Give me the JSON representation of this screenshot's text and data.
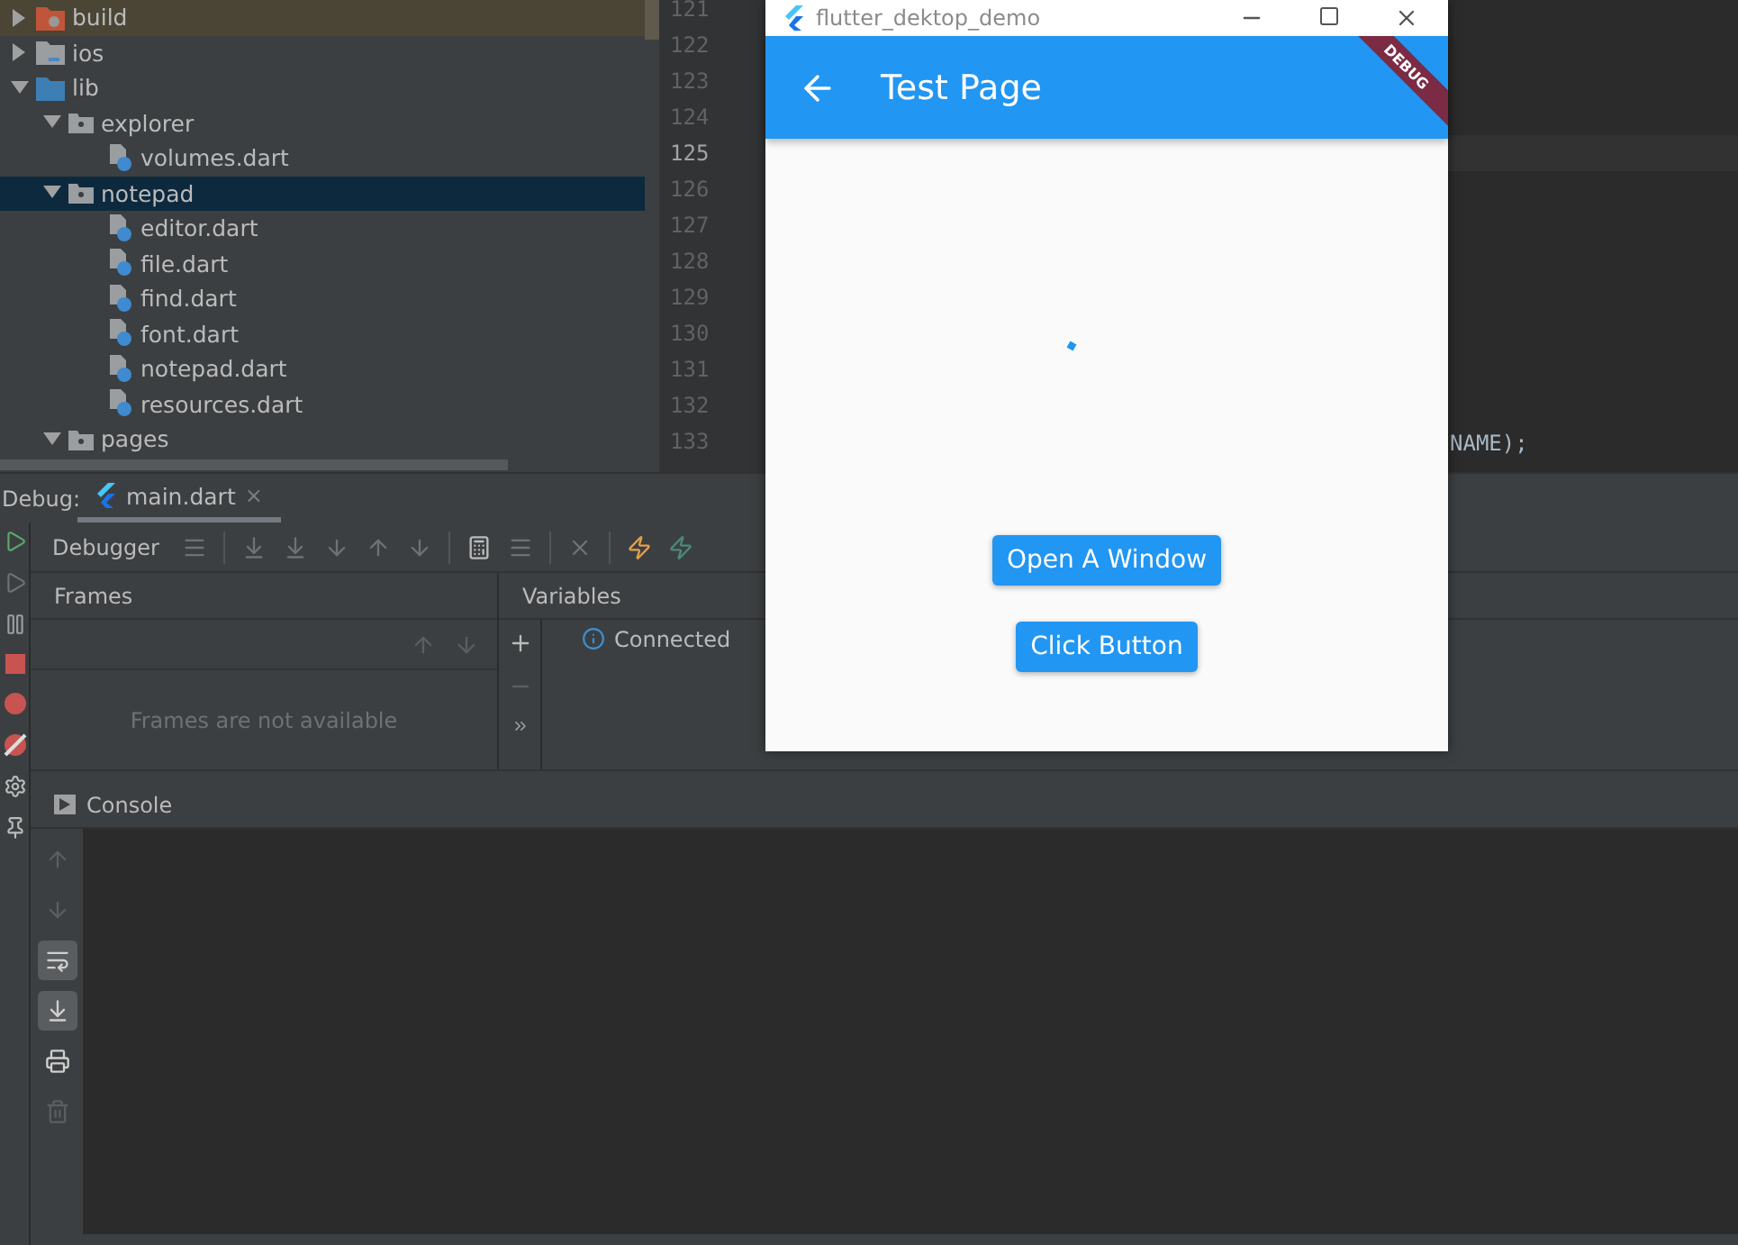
{
  "project_tree": {
    "items": [
      {
        "label": "build",
        "kind": "excluded-folder",
        "expanded": false,
        "selected": false
      },
      {
        "label": "ios",
        "kind": "module-folder",
        "expanded": false,
        "selected": false
      },
      {
        "label": "lib",
        "kind": "source-folder",
        "expanded": true,
        "selected": false,
        "children": [
          {
            "label": "explorer",
            "kind": "package",
            "expanded": true,
            "selected": false,
            "children": [
              {
                "label": "volumes.dart",
                "kind": "dart-file",
                "selected": false
              }
            ]
          },
          {
            "label": "notepad",
            "kind": "package",
            "expanded": true,
            "selected": true,
            "children": [
              {
                "label": "editor.dart",
                "kind": "dart-file",
                "selected": false
              },
              {
                "label": "file.dart",
                "kind": "dart-file",
                "selected": false
              },
              {
                "label": "find.dart",
                "kind": "dart-file",
                "selected": false
              },
              {
                "label": "font.dart",
                "kind": "dart-file",
                "selected": false
              },
              {
                "label": "notepad.dart",
                "kind": "dart-file",
                "selected": false
              },
              {
                "label": "resources.dart",
                "kind": "dart-file",
                "selected": false
              }
            ]
          },
          {
            "label": "pages",
            "kind": "package",
            "expanded": true,
            "selected": false
          }
        ]
      }
    ]
  },
  "editor": {
    "lines": [
      {
        "number": "121",
        "current": false
      },
      {
        "number": "122",
        "current": false
      },
      {
        "number": "123",
        "current": false
      },
      {
        "number": "124",
        "current": false
      },
      {
        "number": "125",
        "current": true
      },
      {
        "number": "126",
        "current": false
      },
      {
        "number": "127",
        "current": false
      },
      {
        "number": "128",
        "current": false
      },
      {
        "number": "129",
        "current": false
      },
      {
        "number": "130",
        "current": false
      },
      {
        "number": "131",
        "current": false
      },
      {
        "number": "132",
        "current": false
      },
      {
        "number": "133",
        "current": false,
        "code": "NAME);"
      }
    ]
  },
  "debug_panel": {
    "label": "Debug:",
    "tabs": [
      {
        "label": "main.dart",
        "selected": true,
        "close": "×"
      }
    ],
    "toolbar_title": "Debugger",
    "frames": {
      "title": "Frames",
      "empty_text": "Frames are not available"
    },
    "variables": {
      "title": "Variables",
      "message": "Connected"
    },
    "console": {
      "title": "Console"
    }
  },
  "app_window": {
    "title": "flutter_dektop_demo",
    "app_bar_title": "Test Page",
    "banner": "DEBUG",
    "buttons": [
      {
        "label": "Open A Window"
      },
      {
        "label": "Click Button"
      }
    ]
  }
}
